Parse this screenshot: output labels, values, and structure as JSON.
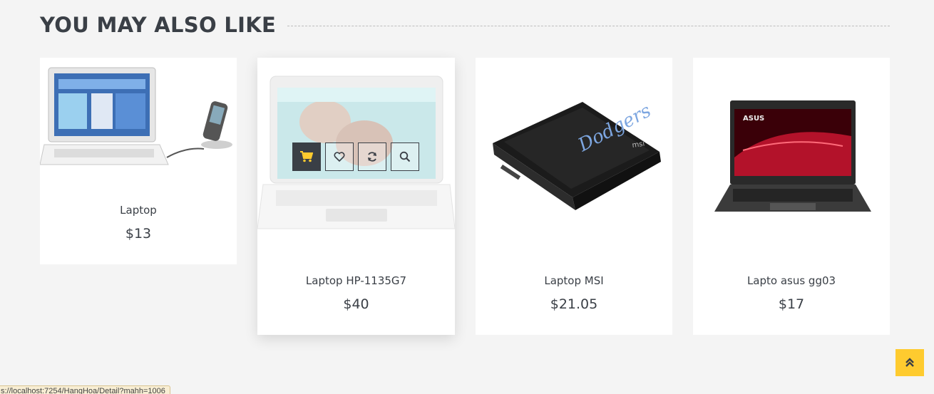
{
  "section": {
    "title": "YOU MAY ALSO LIKE"
  },
  "products": [
    {
      "name": "Laptop",
      "price": "$13",
      "image": "laptop-with-phone-dock"
    },
    {
      "name": "Laptop HP-1135G7",
      "price": "$40",
      "image": "hp-laptop"
    },
    {
      "name": "Laptop MSI",
      "price": "$21.05",
      "image": "msi-black-laptop"
    },
    {
      "name": "Lapto asus gg03",
      "price": "$17",
      "image": "asus-rog-laptop"
    }
  ],
  "hover_actions": [
    "cart-icon",
    "heart-icon",
    "refresh-icon",
    "search-icon"
  ],
  "status_bar": {
    "url": "s://localhost:7254/HangHoa/Detail?mahh=1006"
  },
  "colors": {
    "accent": "#fecb2f",
    "dark": "#3a3f46",
    "background": "#f4f4f4"
  }
}
